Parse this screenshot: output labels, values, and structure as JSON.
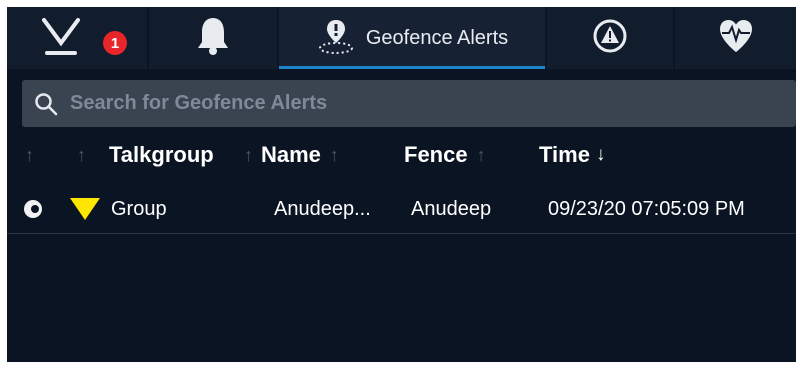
{
  "tabs": [
    {
      "name": "presence",
      "icon": "presence-icon",
      "badge": "1",
      "active": false
    },
    {
      "name": "notifications",
      "icon": "bell-icon",
      "active": false
    },
    {
      "name": "geofence-alerts",
      "icon": "geofence-pin-icon",
      "label": "Geofence Alerts",
      "active": true
    },
    {
      "name": "emergency-alerts",
      "icon": "warning-triangle-icon",
      "active": false
    },
    {
      "name": "status-messages",
      "icon": "heartbeat-icon",
      "active": false
    }
  ],
  "search": {
    "placeholder": "Search for Geofence Alerts",
    "value": ""
  },
  "table": {
    "columns": [
      {
        "label": "",
        "sort": "none"
      },
      {
        "label": "",
        "sort": "none"
      },
      {
        "label": "Talkgroup",
        "sort": "none"
      },
      {
        "label": "Name",
        "sort": "none"
      },
      {
        "label": "Fence",
        "sort": "none"
      },
      {
        "label": "Time",
        "sort": "descending"
      }
    ],
    "rows": [
      {
        "status_icon": "record-dot-icon",
        "type_icon": "direction-triangle-icon",
        "talkgroup": "Group",
        "name": "Anudeep...",
        "fence": "Anudeep",
        "time": "09/23/20 07:05:09 PM"
      }
    ]
  },
  "colors": {
    "background": "#0a1422",
    "tab_active_underline": "#1e86c8",
    "badge": "#e8252b",
    "triangle": "#ffe600"
  }
}
